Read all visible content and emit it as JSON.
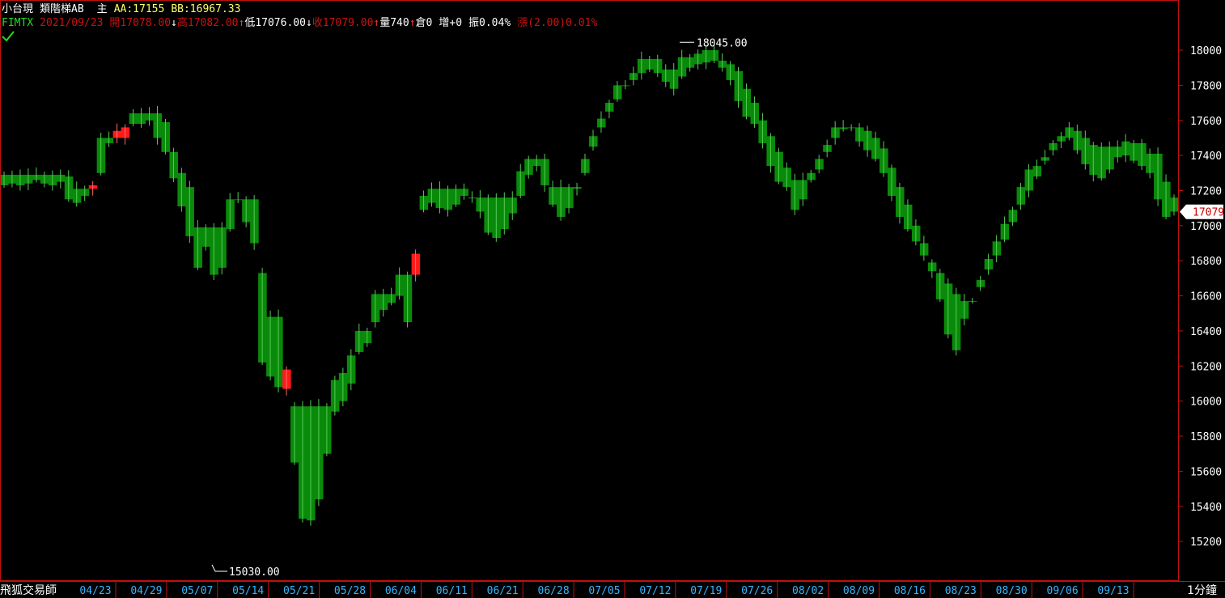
{
  "header": {
    "instrument": "小台現",
    "chart_style": "類階梯AB",
    "main_label": "主",
    "aa_label": "AA:17155",
    "bb_label": "BB:16967.33",
    "symbol": "FIMTX",
    "date": "2021/09/23",
    "open": "開17078.00",
    "high": "高17082.00",
    "low": "低17076.00",
    "close": "收17079.00",
    "volume": "量740",
    "oi": "倉0",
    "oi_change": "增+0",
    "amplitude": "振0.04%",
    "change": "漲(2.00)0.01%"
  },
  "footer": {
    "brand": "飛狐交易師",
    "period": "1分鐘"
  },
  "colors": {
    "background": "#000000",
    "up": "#ff1a1a",
    "down": "#0a8a0a",
    "frame": "#c01010",
    "axis_text": "#ffffff",
    "date_text": "#36b4ff",
    "price_tag_bg": "#ffffff",
    "price_tag_text": "#cc0000"
  },
  "chart_data": {
    "type": "step-area",
    "title": "小台現 類階梯AB",
    "ylim": [
      15030,
      18120
    ],
    "yticks": [
      15200,
      15400,
      15600,
      15800,
      16000,
      16200,
      16400,
      16600,
      16800,
      17000,
      17200,
      17400,
      17600,
      17800,
      18000
    ],
    "ytick_labels": [
      "15200",
      "15400",
      "15600",
      "15800",
      "16000",
      "16200",
      "16400",
      "16600",
      "16800",
      "17000",
      "17200",
      "17400",
      "17600",
      "17800",
      "18000"
    ],
    "xticks": [
      "04/23",
      "04/29",
      "05/07",
      "05/14",
      "05/21",
      "05/28",
      "06/04",
      "06/11",
      "06/21",
      "06/28",
      "07/05",
      "07/12",
      "07/19",
      "07/26",
      "08/02",
      "08/09",
      "08/16",
      "08/23",
      "08/30",
      "09/06",
      "09/13"
    ],
    "annotations": {
      "high_label": "18045.00",
      "high_value": 18045,
      "low_label": "15030.00",
      "low_value": 15030,
      "last_price_label": "17079",
      "last_price": 17079
    },
    "series": [
      {
        "name": "A",
        "values": [
          17230,
          17240,
          17230,
          17240,
          17260,
          17240,
          17230,
          17250,
          17150,
          17130,
          17170,
          17230,
          17300,
          17470,
          17540,
          17560,
          17580,
          17580,
          17600,
          17500,
          17420,
          17270,
          17110,
          16940,
          16760,
          16880,
          16720,
          16760,
          16980,
          17150,
          17020,
          16900,
          16220,
          16140,
          16080,
          16180,
          15650,
          15330,
          15320,
          15440,
          15700,
          15940,
          16000,
          16100,
          16280,
          16330,
          16450,
          16520,
          16560,
          16600,
          16450,
          16840,
          17090,
          17130,
          17100,
          17090,
          17120,
          17170,
          17160,
          17080,
          16960,
          16930,
          16980,
          17070,
          17170,
          17290,
          17340,
          17230,
          17120,
          17050,
          17100,
          17210,
          17300,
          17450,
          17560,
          17650,
          17720,
          17800,
          17830,
          17870,
          17890,
          17870,
          17820,
          17780,
          17850,
          17900,
          17920,
          17930,
          17940,
          17900,
          17830,
          17710,
          17620,
          17580,
          17470,
          17340,
          17250,
          17220,
          17090,
          17150,
          17260,
          17320,
          17420,
          17500,
          17550,
          17560,
          17480,
          17430,
          17380,
          17300,
          17170,
          17050,
          16980,
          16910,
          16830,
          16740,
          16580,
          16380,
          16290,
          16470,
          16570,
          16650,
          16750,
          16830,
          16920,
          17020,
          17120,
          17200,
          17280,
          17370,
          17430,
          17480,
          17500,
          17430,
          17350,
          17290,
          17270,
          17320,
          17390,
          17400,
          17370,
          17340,
          17300,
          17150,
          17050,
          17080
        ]
      },
      {
        "name": "B",
        "values": [
          17290,
          17290,
          17290,
          17290,
          17290,
          17290,
          17290,
          17290,
          17280,
          17210,
          17210,
          17210,
          17500,
          17500,
          17500,
          17500,
          17640,
          17640,
          17640,
          17640,
          17590,
          17420,
          17300,
          17220,
          16990,
          16990,
          16990,
          16990,
          17150,
          17150,
          17150,
          17150,
          16730,
          16480,
          16480,
          16070,
          15970,
          15970,
          15970,
          15970,
          15970,
          16120,
          16160,
          16260,
          16400,
          16400,
          16610,
          16610,
          16610,
          16720,
          16720,
          16720,
          17170,
          17210,
          17210,
          17210,
          17210,
          17210,
          17160,
          17160,
          17160,
          17160,
          17160,
          17160,
          17310,
          17380,
          17380,
          17380,
          17220,
          17220,
          17220,
          17220,
          17380,
          17510,
          17610,
          17700,
          17800,
          17800,
          17870,
          17950,
          17950,
          17950,
          17890,
          17890,
          17960,
          17960,
          17980,
          18000,
          18000,
          17940,
          17920,
          17880,
          17780,
          17700,
          17600,
          17510,
          17420,
          17330,
          17260,
          17260,
          17300,
          17380,
          17460,
          17560,
          17560,
          17560,
          17560,
          17540,
          17500,
          17440,
          17330,
          17220,
          17120,
          17000,
          16900,
          16790,
          16730,
          16670,
          16610,
          16570,
          16570,
          16690,
          16810,
          16910,
          17010,
          17090,
          17220,
          17320,
          17340,
          17390,
          17470,
          17510,
          17560,
          17540,
          17500,
          17460,
          17450,
          17450,
          17450,
          17480,
          17470,
          17470,
          17410,
          17410,
          17250,
          17160
        ]
      }
    ]
  }
}
